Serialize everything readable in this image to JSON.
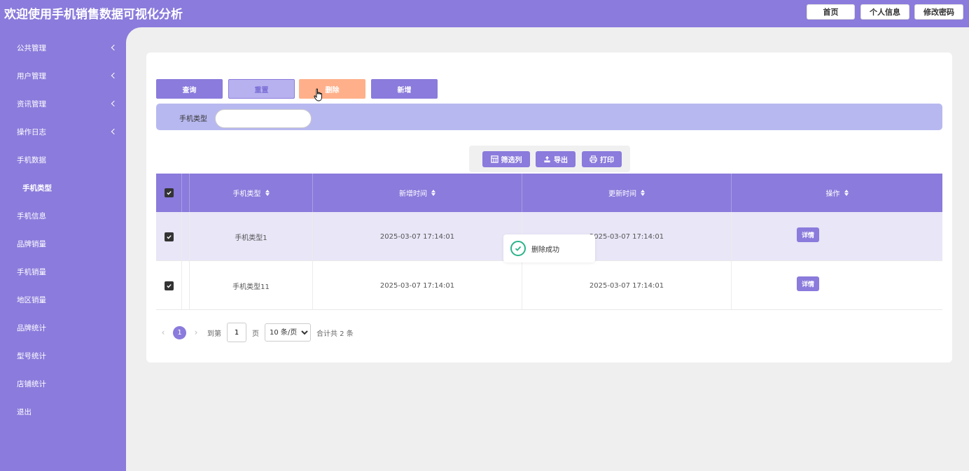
{
  "app": {
    "title": "欢迎使用手机销售数据可视化分析"
  },
  "topnav": {
    "home": "首页",
    "profile": "个人信息",
    "change_password": "修改密码"
  },
  "sidebar": {
    "items": [
      {
        "label": "公共管理",
        "expandable": true
      },
      {
        "label": "用户管理",
        "expandable": true
      },
      {
        "label": "资讯管理",
        "expandable": true
      },
      {
        "label": "操作日志",
        "expandable": true
      },
      {
        "label": "手机数据",
        "expandable": false
      },
      {
        "label": "手机类型",
        "expandable": false,
        "sub": true,
        "active": true
      },
      {
        "label": "手机信息",
        "expandable": false
      },
      {
        "label": "品牌销量",
        "expandable": false
      },
      {
        "label": "手机销量",
        "expandable": false
      },
      {
        "label": "地区销量",
        "expandable": false
      },
      {
        "label": "品牌统计",
        "expandable": false
      },
      {
        "label": "型号统计",
        "expandable": false
      },
      {
        "label": "店铺统计",
        "expandable": false
      },
      {
        "label": "退出",
        "expandable": false
      }
    ]
  },
  "actions": {
    "query": "查询",
    "reset": "重置",
    "delete": "删除",
    "add": "新增"
  },
  "search": {
    "label": "手机类型",
    "value": "",
    "placeholder": ""
  },
  "toolbar": {
    "filter_columns": "筛选列",
    "export": "导出",
    "print": "打印"
  },
  "table": {
    "headers": {
      "type": "手机类型",
      "created": "新增时间",
      "updated": "更新时间",
      "ops": "操作"
    },
    "rows": [
      {
        "type": "手机类型1",
        "created": "2025-03-07 17:14:01",
        "updated": "2025-03-07 17:14:01",
        "detail": "详情",
        "checked": true
      },
      {
        "type": "手机类型11",
        "created": "2025-03-07 17:14:01",
        "updated": "2025-03-07 17:14:01",
        "detail": "详情",
        "checked": true
      }
    ]
  },
  "pager": {
    "current": "1",
    "goto_prefix": "到第",
    "goto_value": "1",
    "goto_suffix": "页",
    "page_size": "10 条/页",
    "total": "合计共 2 条"
  },
  "toast": {
    "message": "删除成功"
  },
  "colors": {
    "primary": "#8a7bdc",
    "delete": "#ffb08a",
    "search_bg": "#b8b8f0",
    "success": "#2bb38a"
  }
}
